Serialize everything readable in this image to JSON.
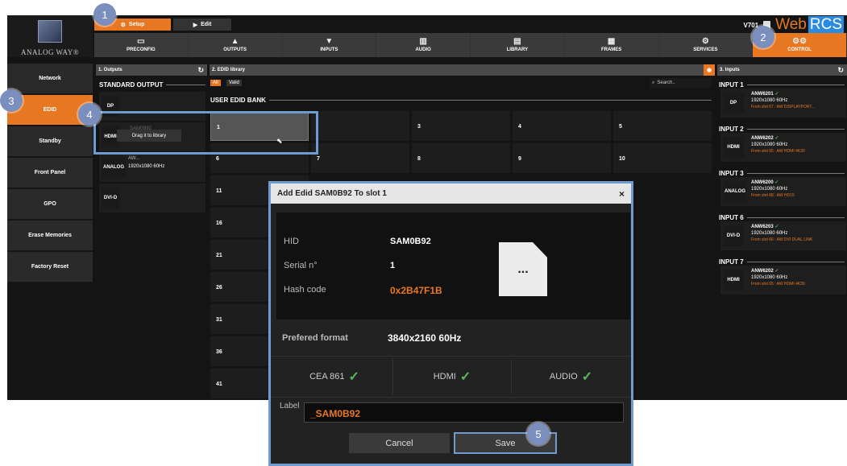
{
  "header": {
    "logo_text": "ANALOG WAY®",
    "mode_tabs": [
      {
        "label": "Setup",
        "active": true
      },
      {
        "label": "Edit",
        "active": false
      }
    ],
    "version": "V701",
    "brand_web": "Web",
    "brand_rcs": "RCS"
  },
  "nav": {
    "items": [
      {
        "label": "PRECONFIG",
        "icon": "preconfig-icon"
      },
      {
        "label": "OUTPUTS",
        "icon": "outputs-icon"
      },
      {
        "label": "INPUTS",
        "icon": "inputs-icon"
      },
      {
        "label": "AUDIO",
        "icon": "audio-icon"
      },
      {
        "label": "LIBRARY",
        "icon": "library-icon"
      },
      {
        "label": "FRAMES",
        "icon": "frames-icon"
      },
      {
        "label": "SERVICES",
        "icon": "services-icon"
      },
      {
        "label": "CONTROL",
        "icon": "gears-icon",
        "active": true
      }
    ]
  },
  "sidebar": {
    "items": [
      {
        "label": "Network"
      },
      {
        "label": "EDID",
        "active": true
      },
      {
        "label": "Standby"
      },
      {
        "label": "Front Panel"
      },
      {
        "label": "GPO"
      },
      {
        "label": "Erase Memories"
      },
      {
        "label": "Factory Reset"
      }
    ]
  },
  "outputs_panel": {
    "title": "1. Outputs",
    "section": "STANDARD OUTPUT",
    "rows": [
      {
        "tag": "DP",
        "line1": "",
        "line2": ""
      },
      {
        "tag": "HDMI",
        "line1": "SAM0B92",
        "line2": "Drag it to library"
      },
      {
        "tag": "ANALOG",
        "line1": "AW...",
        "line2": "1920x1080 60Hz"
      },
      {
        "tag": "DVI-D",
        "line1": "",
        "line2": ""
      }
    ]
  },
  "edid_panel": {
    "title": "2. EDID library",
    "filter_all": "All",
    "filter_valid": "Valid",
    "search_placeholder": "Search..",
    "section": "USER EDID BANK",
    "cells": [
      "1",
      "",
      "3",
      "4",
      "5",
      "6",
      "7",
      "8",
      "9",
      "10",
      "11",
      "16",
      "21",
      "26",
      "31",
      "36",
      "41"
    ]
  },
  "inputs_panel": {
    "title": "3. Inputs",
    "groups": [
      {
        "label": "INPUT 1",
        "tag": "DP",
        "name": "ANW6201",
        "res": "1920x1080 60Hz",
        "slot": "From slot 67 : AW DISPLAYPORT..."
      },
      {
        "label": "INPUT 2",
        "tag": "HDMI",
        "name": "ANW6202",
        "res": "1920x1080 60Hz",
        "slot": "From slot 65 : AW HDMI 4K30"
      },
      {
        "label": "INPUT 3",
        "tag": "ANALOG",
        "name": "ANW6200",
        "res": "1920x1080 60Hz",
        "slot": "From slot 68 : AW HD15"
      },
      {
        "label": "INPUT 6",
        "tag": "DVI-D",
        "name": "ANW6203",
        "res": "1920x1080 60Hz",
        "slot": "From slot 66 : AW DVI DUAL LINK"
      },
      {
        "label": "INPUT 7",
        "tag": "HDMI",
        "name": "ANW6202",
        "res": "1920x1080 60Hz",
        "slot": "From slot 65 : AW HDMI 4K30"
      }
    ]
  },
  "dialog": {
    "title": "Add Edid SAM0B92 To slot 1",
    "close": "×",
    "hid_label": "HID",
    "hid_value": "SAM0B92",
    "serial_label": "Serial n°",
    "serial_value": "1",
    "hash_label": "Hash code",
    "hash_value": "0x2B47F1B",
    "format_label": "Prefered format",
    "format_value": "3840x2160 60Hz",
    "caps": [
      "CEA 861",
      "HDMI",
      "AUDIO"
    ],
    "label_caption": "Label",
    "label_value": "_SAM0B92",
    "cancel": "Cancel",
    "save": "Save",
    "file_icon_text": "..."
  },
  "callouts": [
    "1",
    "2",
    "3",
    "4",
    "5"
  ],
  "colors": {
    "accent": "#e87722",
    "callout": "#7b8fbf",
    "highlight": "#6f9bd0",
    "check": "#5cb85c"
  }
}
